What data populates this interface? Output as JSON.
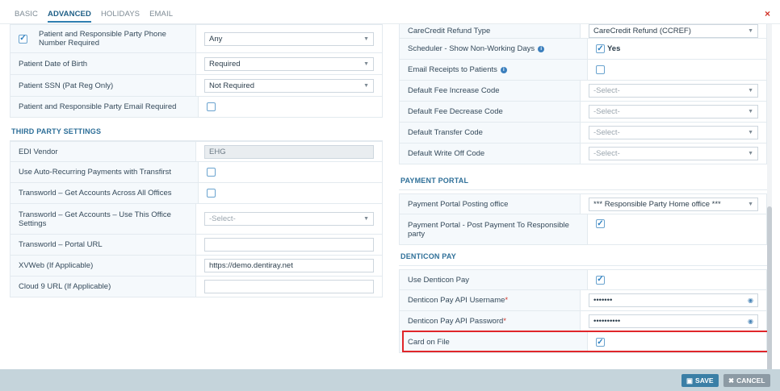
{
  "tabs": [
    {
      "label": "BASIC"
    },
    {
      "label": "ADVANCED",
      "active": true
    },
    {
      "label": "HOLIDAYS"
    },
    {
      "label": "EMAIL"
    }
  ],
  "close_label": "×",
  "left": {
    "rows_top": [
      {
        "label": "Patient and Responsible Party Phone Number Required",
        "value": "Any",
        "checked": true
      },
      {
        "label": "Patient Date of Birth",
        "value": "Required"
      },
      {
        "label": "Patient SSN (Pat Reg Only)",
        "value": "Not Required"
      },
      {
        "label": "Patient and Responsible Party Email Required",
        "checked": false
      }
    ],
    "third_party_title": "THIRD PARTY SETTINGS",
    "third_party_rows": [
      {
        "label": "EDI Vendor",
        "value": "EHG"
      },
      {
        "label": "Use Auto-Recurring Payments with Transfirst",
        "checked": false
      },
      {
        "label": "Transworld – Get Accounts Across All Offices",
        "checked": false
      },
      {
        "label": "Transworld – Get Accounts – Use This Office Settings",
        "placeholder": "-Select-"
      },
      {
        "label": "Transworld – Portal URL",
        "value": ""
      },
      {
        "label": "XVWeb (If Applicable)",
        "value": "https://demo.dentiray.net"
      },
      {
        "label": "Cloud 9 URL (If Applicable)",
        "value": ""
      }
    ]
  },
  "right": {
    "rows_top": [
      {
        "label": "CareCredit Refund Type",
        "value": "CareCredit Refund (CCREF)"
      },
      {
        "label": "Scheduler - Show Non-Working Days",
        "yes_label": "Yes",
        "checked": true
      },
      {
        "label": "Email Receipts to Patients",
        "checked": false
      },
      {
        "label": "Default Fee Increase Code",
        "placeholder": "-Select-"
      },
      {
        "label": "Default Fee Decrease Code",
        "placeholder": "-Select-"
      },
      {
        "label": "Default Transfer Code",
        "placeholder": "-Select-"
      },
      {
        "label": "Default Write Off Code",
        "placeholder": "-Select-"
      }
    ],
    "payment_portal_title": "PAYMENT PORTAL",
    "payment_rows": [
      {
        "label": "Payment Portal Posting office",
        "value": "*** Responsible Party Home office ***"
      },
      {
        "label": "Payment Portal - Post Payment To Responsible party",
        "checked": true
      }
    ],
    "denticon_title": "DENTICON PAY",
    "denticon_rows": [
      {
        "label": "Use Denticon Pay",
        "checked": true
      },
      {
        "label": "Denticon Pay API Username",
        "required_mark": "*",
        "value": "•••••••"
      },
      {
        "label": "Denticon Pay API Password",
        "required_mark": "*",
        "value": "••••••••••"
      },
      {
        "label": "Card on File",
        "checked": true
      }
    ]
  },
  "footer": {
    "save_label": "SAVE",
    "cancel_label": "CANCEL"
  },
  "colors": {
    "accent": "#2f7fb0",
    "highlight": "#e0262a",
    "footer_bg": "#c5d4db"
  }
}
